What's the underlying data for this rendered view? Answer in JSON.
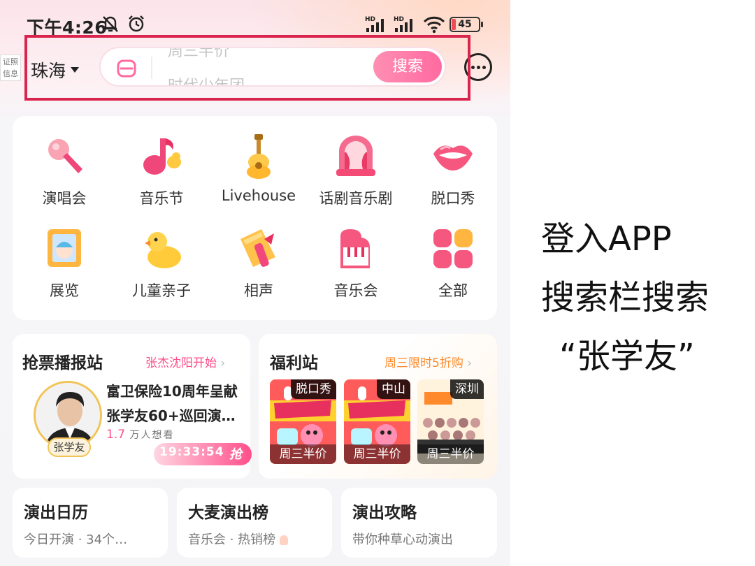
{
  "status_bar": {
    "time": "下午4:26",
    "hd1": "HD",
    "hd2": "HD",
    "battery": "45"
  },
  "license_tag": "证照信息",
  "header": {
    "city": "珠海",
    "search_hints": [
      "周三半价",
      "时代少年团"
    ],
    "search_button": "搜索"
  },
  "categories": [
    {
      "label": "演唱会",
      "icon": "microphone-icon"
    },
    {
      "label": "音乐节",
      "icon": "music-note-icon"
    },
    {
      "label": "Livehouse",
      "icon": "guitar-icon"
    },
    {
      "label": "话剧音乐剧",
      "icon": "theater-stage-icon"
    },
    {
      "label": "脱口秀",
      "icon": "lips-icon"
    },
    {
      "label": "展览",
      "icon": "picture-frame-icon"
    },
    {
      "label": "儿童亲子",
      "icon": "duck-icon"
    },
    {
      "label": "相声",
      "icon": "fan-icon"
    },
    {
      "label": "音乐会",
      "icon": "piano-icon"
    },
    {
      "label": "全部",
      "icon": "grid-icon"
    }
  ],
  "ticket_news": {
    "title": "抢票播报站",
    "link": "张杰沈阳开始",
    "avatar_tag": "张学友",
    "line1": "富卫保险10周年呈献",
    "line2": "张学友60+巡回演…",
    "want_count": "1.7",
    "want_text": "万人想看",
    "countdown": "19:33:54",
    "grab": "抢"
  },
  "welfare": {
    "title": "福利站",
    "link": "周三限时5折购",
    "items": [
      {
        "city": "脱口秀",
        "band": "周三半价"
      },
      {
        "city": "中山",
        "band": "周三半价"
      },
      {
        "city": "深圳",
        "band": "周三半价"
      }
    ]
  },
  "bottom_cards": [
    {
      "title": "演出日历",
      "desc": "今日开演 · 34个…"
    },
    {
      "title": "大麦演出榜",
      "desc": "音乐会 · 热销榜"
    },
    {
      "title": "演出攻略",
      "desc": "带你种草心动演出"
    }
  ],
  "annotation": {
    "line1": "登入APP",
    "line2": "搜索栏搜索",
    "line3": "“张学友”"
  },
  "colors": {
    "accent_pink": "#ff4f8b",
    "highlight_red": "#d9254d",
    "orange": "#ff8a2b"
  }
}
